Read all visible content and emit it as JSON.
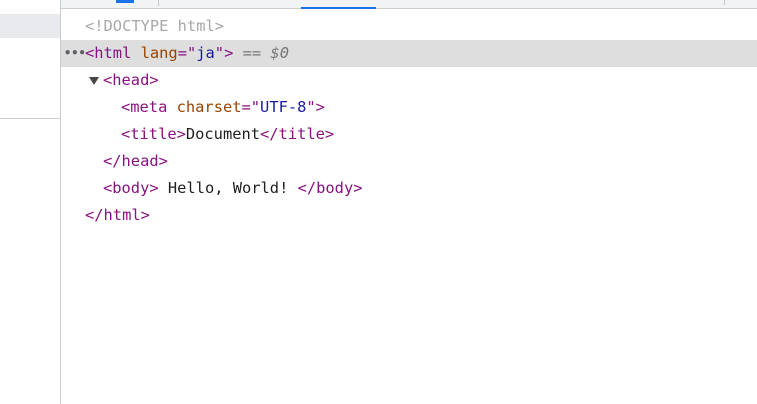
{
  "dom_tree": {
    "doctype": "<!DOCTYPE html>",
    "html_open": {
      "tag_open": "<html",
      "attr_name": "lang",
      "attr_eq": "=\"",
      "attr_value": "ja",
      "attr_close": "\"",
      "tag_close": ">",
      "selected_suffix": " == $0"
    },
    "head_open": "<head>",
    "meta": {
      "tag_open": "<meta",
      "attr_name": "charset",
      "attr_eq": "=\"",
      "attr_value": "UTF-8",
      "attr_close": "\"",
      "tag_close": ">"
    },
    "title": {
      "open": "<title>",
      "text": "Document",
      "close": "</title>"
    },
    "head_close": "</head>",
    "body": {
      "open": "<body>",
      "text": " Hello, World! ",
      "close": "</body>"
    },
    "html_close": "</html>",
    "selected_dots": "•••",
    "expand_icon": "triangle-down"
  }
}
